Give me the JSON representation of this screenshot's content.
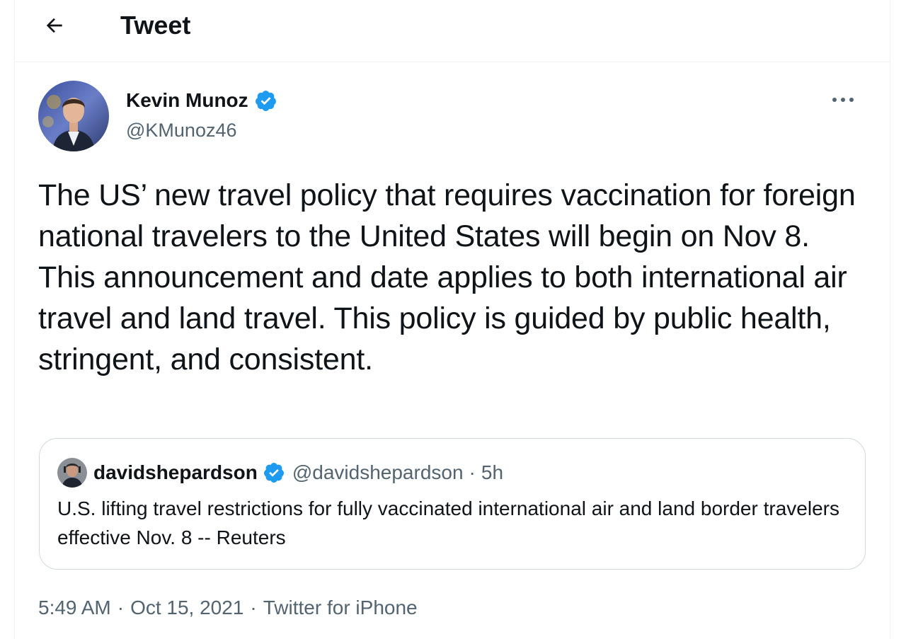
{
  "header": {
    "title": "Tweet",
    "back_icon": "arrow-left-icon"
  },
  "tweet": {
    "author": {
      "name": "Kevin Munoz",
      "handle": "@KMunoz46",
      "verified": true
    },
    "more_icon": "more-dots-icon",
    "text": "The US’ new travel policy that requires vaccination for foreign national travelers to the United States will begin on Nov 8. This announcement and date applies to both international air travel and land travel. This policy is guided by public health, stringent, and consistent.",
    "quoted": {
      "name": "davidshepardson",
      "handle": "@davidshepardson",
      "separator": "·",
      "time": "5h",
      "verified": true,
      "text": "U.S. lifting travel restrictions for fully vaccinated international air and land border travelers effective Nov. 8 -- Reuters"
    },
    "meta": {
      "time": "5:49 AM",
      "separator": "·",
      "date": "Oct 15, 2021",
      "source": "Twitter for iPhone"
    }
  },
  "colors": {
    "text_primary": "#0f1419",
    "text_secondary": "#536471",
    "verified_blue": "#1d9bf0",
    "border": "#cfd9de",
    "divider": "#eff3f4"
  }
}
